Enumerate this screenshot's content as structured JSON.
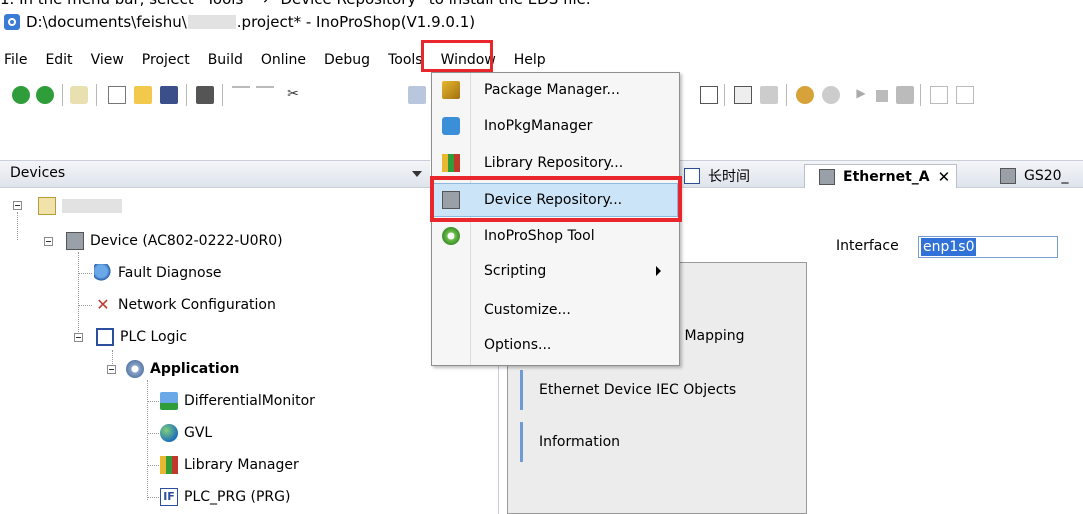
{
  "caption": "1. In the menu bar, select “Tools” → “Device Repository” to install the EDS file.",
  "window": {
    "title_prefix": "D:\\documents\\feishu\\",
    "title_suffix": ".project* - InoProShop(V1.9.0.1)"
  },
  "menubar": {
    "items": [
      "File",
      "Edit",
      "View",
      "Project",
      "Build",
      "Online",
      "Debug",
      "Tools",
      "Window",
      "Help"
    ]
  },
  "tools_menu": {
    "items": [
      {
        "label": "Package Manager...",
        "icon": "package-icon"
      },
      {
        "label": "InoPkgManager",
        "icon": "cube-icon"
      },
      {
        "label": "Library Repository...",
        "icon": "books-icon"
      },
      {
        "label": "Device Repository...",
        "icon": "device-icon"
      },
      {
        "label": "InoProShop Tool",
        "icon": "gear-green-icon"
      },
      {
        "label": "Scripting",
        "icon": "",
        "submenu": true
      },
      {
        "label": "Customize...",
        "icon": ""
      },
      {
        "label": "Options...",
        "icon": ""
      }
    ]
  },
  "devices_pane": {
    "header": "Devices",
    "tree": [
      {
        "label": "Device (AC802-0222-U0R0)",
        "icon": "device-icon"
      },
      {
        "label": "Fault Diagnose",
        "icon": "magnifier-icon"
      },
      {
        "label": "Network Configuration",
        "icon": "tools-icon"
      },
      {
        "label": "PLC Logic",
        "icon": "plc-logic-icon"
      },
      {
        "label": "Application",
        "icon": "gear-icon"
      },
      {
        "label": "DifferentialMonitor",
        "icon": "monitor-icon"
      },
      {
        "label": "GVL",
        "icon": "globe-icon"
      },
      {
        "label": "Library Manager",
        "icon": "books-icon"
      },
      {
        "label": "PLC_PRG (PRG)",
        "icon": "program-icon"
      }
    ]
  },
  "editor": {
    "tabs": [
      {
        "label": "长时间"
      },
      {
        "label": "Ethernet_A",
        "active": true
      },
      {
        "label": "GS20_"
      }
    ],
    "interface_label": "Interface",
    "interface_value": "enp1s0",
    "nav_items": [
      "O Mapping",
      "Ethernet Device IEC Objects",
      "Information"
    ]
  },
  "colors": {
    "highlight_red": "#e8262b",
    "hover_blue": "#cce4f7",
    "selection_blue": "#3172d8"
  }
}
